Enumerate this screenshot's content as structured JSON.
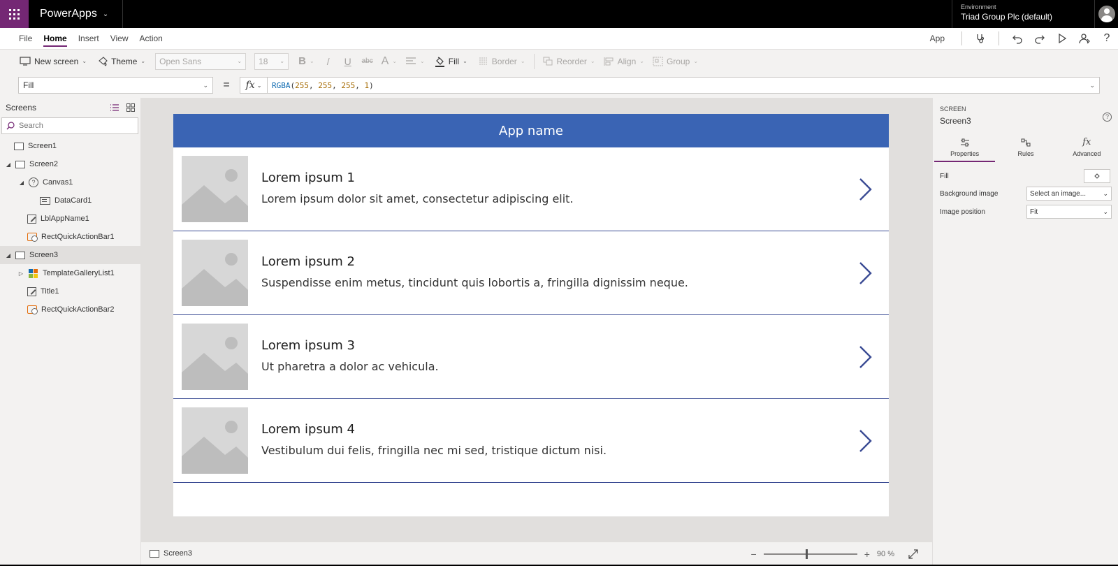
{
  "topbar": {
    "app_name": "PowerApps",
    "environment_label": "Environment",
    "environment_name": "Triad Group Plc (default)"
  },
  "menu": {
    "items": [
      "File",
      "Home",
      "Insert",
      "View",
      "Action"
    ],
    "active": "Home",
    "app_label": "App"
  },
  "toolbar": {
    "new_screen": "New screen",
    "theme": "Theme",
    "font_family": "Open Sans",
    "font_size": "18",
    "bold": "B",
    "italic": "/",
    "underline": "U",
    "strike": "abc",
    "font_color": "A",
    "fill": "Fill",
    "border": "Border",
    "reorder": "Reorder",
    "align": "Align",
    "group": "Group"
  },
  "formula_bar": {
    "property": "Fill",
    "equals": "=",
    "fx": "fx",
    "fn": "RGBA",
    "open_paren": "(",
    "r": "255",
    "g": "255",
    "b": "255",
    "a": "1",
    "comma": ", ",
    "close_paren": ")"
  },
  "left_panel": {
    "title": "Screens",
    "search_placeholder": "Search",
    "tree": [
      {
        "label": "Screen1"
      },
      {
        "label": "Screen2"
      },
      {
        "label": "Canvas1"
      },
      {
        "label": "DataCard1"
      },
      {
        "label": "LblAppName1"
      },
      {
        "label": "RectQuickActionBar1"
      },
      {
        "label": "Screen3"
      },
      {
        "label": "TemplateGalleryList1"
      },
      {
        "label": "Title1"
      },
      {
        "label": "RectQuickActionBar2"
      }
    ]
  },
  "app_preview": {
    "header": "App name",
    "header_color": "#3a64b4",
    "divider_color": "#3a4b94",
    "items": [
      {
        "title": "Lorem ipsum 1",
        "subtitle": "Lorem ipsum dolor sit amet, consectetur adipiscing elit."
      },
      {
        "title": "Lorem ipsum 2",
        "subtitle": "Suspendisse enim metus, tincidunt quis lobortis a, fringilla dignissim neque."
      },
      {
        "title": "Lorem ipsum 3",
        "subtitle": "Ut pharetra a dolor ac vehicula."
      },
      {
        "title": "Lorem ipsum 4",
        "subtitle": "Vestibulum dui felis, fringilla nec mi sed, tristique dictum nisi."
      }
    ]
  },
  "statusbar": {
    "screen_name": "Screen3",
    "zoom_minus": "−",
    "zoom_plus": "+",
    "zoom_value": "90",
    "zoom_unit": "%"
  },
  "right_panel": {
    "type_label": "SCREEN",
    "screen_name": "Screen3",
    "tabs": [
      "Properties",
      "Rules",
      "Advanced"
    ],
    "active_tab": "Properties",
    "fill_label": "Fill",
    "background_image_label": "Background image",
    "background_image_value": "Select an image...",
    "image_position_label": "Image position",
    "image_position_value": "Fit"
  },
  "colors": {
    "brand_purple": "#742774",
    "accent_blue": "#0f6bb1"
  }
}
